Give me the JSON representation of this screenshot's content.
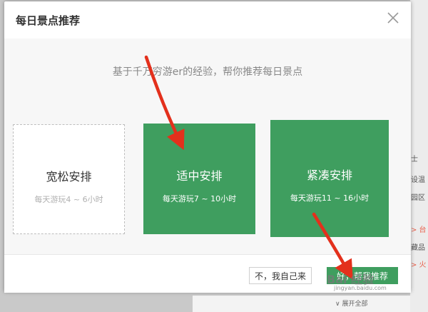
{
  "dialog": {
    "title": "每日景点推荐",
    "subtitle": "基于千万穷游er的经验，帮你推荐每日景点"
  },
  "options": [
    {
      "name": "宽松安排",
      "desc": "每天游玩4 ~ 6小时",
      "selected": false
    },
    {
      "name": "适中安排",
      "desc": "每天游玩7 ~ 10小时",
      "selected": true
    },
    {
      "name": "紧凑安排",
      "desc": "每天游玩11 ~ 16小时",
      "selected": true
    }
  ],
  "footer": {
    "cancel_label": "不，我自己来",
    "confirm_label": "好，帮我推荐"
  },
  "background": {
    "right_snippets": [
      "士",
      "设温",
      "园区",
      "> 台",
      "藏品",
      "> 火"
    ],
    "bottom_link": "∨ 展开全部"
  },
  "watermark": {
    "text": "Bai 经验",
    "url": "jingyan.baidu.com"
  },
  "colors": {
    "accent_green": "#3f9e5f",
    "arrow_red": "#e3301c"
  }
}
